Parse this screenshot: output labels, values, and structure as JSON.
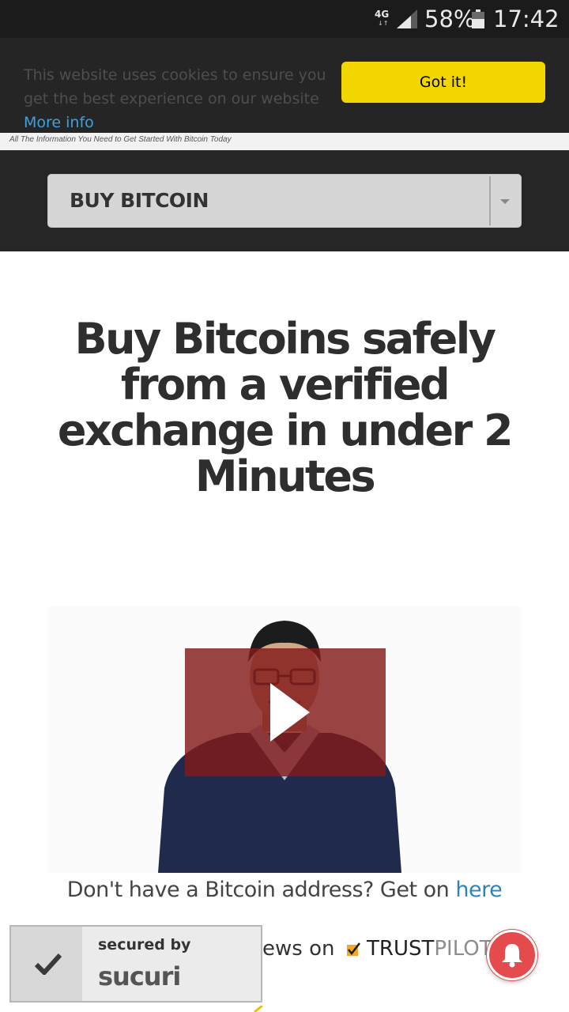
{
  "status_bar": {
    "network": "4G",
    "battery_percent": "58%",
    "time": "17:42"
  },
  "cookie_banner": {
    "message": "This website uses cookies to ensure you get the best experience on our website",
    "more_info_link": "More info",
    "accept_button": "Got it!",
    "colors": {
      "background": "#252525",
      "button": "#f1d600",
      "link": "#3ea1de"
    }
  },
  "tagline": "All The Information You Need to Get Started With Bitcoin Today",
  "nav": {
    "select_value": "BUY BITCOIN"
  },
  "hero": {
    "headline": "Buy Bitcoins safely from a verified exchange in under 2 Minutes"
  },
  "video": {
    "play_icon": "play-icon",
    "overlay_color": "#821a1a"
  },
  "address_prompt": {
    "text": "Don't have a Bitcoin address? Get on ",
    "link": "here"
  },
  "reviews": {
    "partial_text": "ews on",
    "brand_trust": "TRUST",
    "brand_pilot": "PILOT"
  },
  "security_badge": {
    "label": "secured by",
    "brand": "sucuri"
  },
  "notification_button": {
    "icon": "bell-icon",
    "color": "#e54b4d"
  }
}
